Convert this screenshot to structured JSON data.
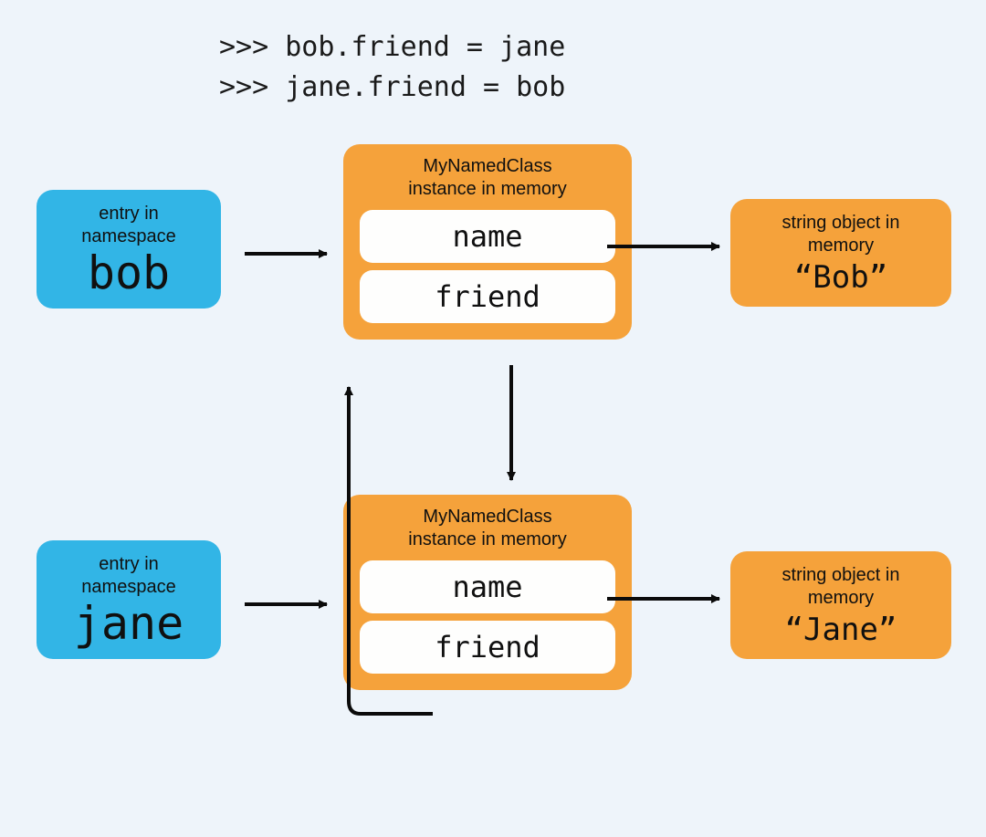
{
  "code": {
    "line1": ">>> bob.friend = jane",
    "line2": ">>> jane.friend = bob"
  },
  "namespace": {
    "label": "entry in\nnamespace",
    "bob": "bob",
    "jane": "jane"
  },
  "instance": {
    "label": "MyNamedClass\ninstance in memory",
    "slot_name": "name",
    "slot_friend": "friend"
  },
  "string": {
    "label": "string object in\nmemory",
    "bob_value": "“Bob”",
    "jane_value": "“Jane”"
  }
}
